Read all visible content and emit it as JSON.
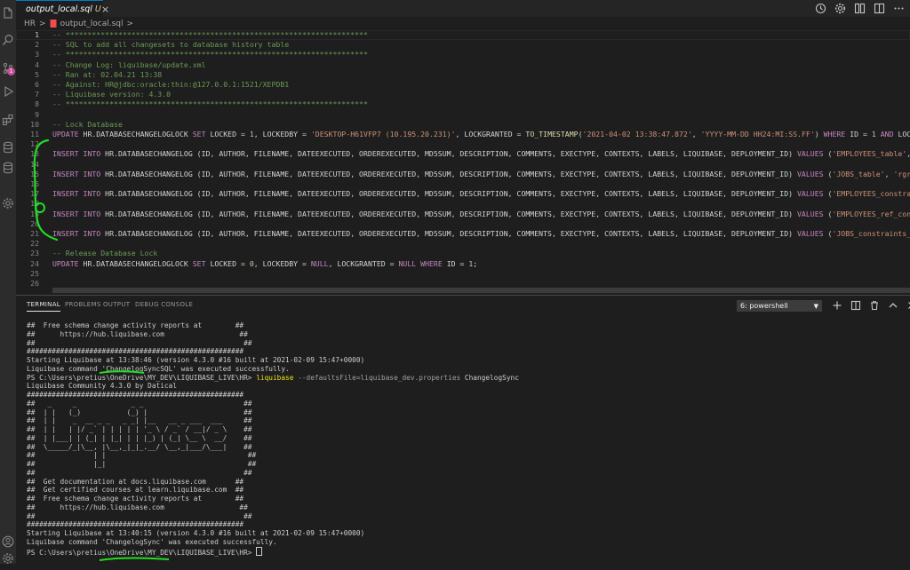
{
  "colors": {
    "accent": "#007acc",
    "comment": "#6a9955",
    "keyword": "#c586c0",
    "string": "#ce9178",
    "number": "#b5cea8",
    "function": "#dcdcaa",
    "terminal_command": "#e5e510",
    "annotation": "#22dd22"
  },
  "activity_bar": {
    "icons": [
      "files-icon",
      "search-icon",
      "source-control-icon",
      "run-debug-icon",
      "extensions-icon",
      "database-icon",
      "database-icon",
      "settings-gear-icon",
      "account-icon",
      "manage-gear-icon"
    ],
    "badge": "1"
  },
  "tab": {
    "label": "output_local.sql",
    "status": "U",
    "close": "×"
  },
  "editor_actions": [
    "history-icon",
    "gear-icon",
    "compare-icon",
    "split-editor-icon",
    "more-icon"
  ],
  "breadcrumb": {
    "folder": "HR",
    "sep": ">",
    "file": "output_local.sql",
    "tail": ">"
  },
  "editor": {
    "line_numbers": [
      "1",
      "2",
      "3",
      "4",
      "5",
      "6",
      "7",
      "8",
      "9",
      "10",
      "11",
      "12",
      "13",
      "14",
      "15",
      "16",
      "17",
      "18",
      "19",
      "20",
      "21",
      "22",
      "23",
      "24",
      "25",
      "26"
    ],
    "lines": [
      [
        {
          "t": "cmt",
          "v": "-- *********************************************************************"
        }
      ],
      [
        {
          "t": "cmt",
          "v": "-- SQL to add all changesets to database history table"
        }
      ],
      [
        {
          "t": "cmt",
          "v": "-- *********************************************************************"
        }
      ],
      [
        {
          "t": "cmt",
          "v": "-- Change Log: liquibase/update.xml"
        }
      ],
      [
        {
          "t": "cmt",
          "v": "-- Ran at: 02.04.21 13:38"
        }
      ],
      [
        {
          "t": "cmt",
          "v": "-- Against: HR@jdbc:oracle:thin:@127.0.0.1:1521/XEPDB1"
        }
      ],
      [
        {
          "t": "cmt",
          "v": "-- Liquibase version: 4.3.0"
        }
      ],
      [
        {
          "t": "cmt",
          "v": "-- *********************************************************************"
        }
      ],
      [],
      [
        {
          "t": "cmt",
          "v": "-- Lock Database"
        }
      ],
      [
        {
          "t": "kw",
          "v": "UPDATE "
        },
        {
          "t": "idn",
          "v": "HR.DATABASECHANGELOGLOCK "
        },
        {
          "t": "kw",
          "v": "SET "
        },
        {
          "t": "idn",
          "v": "LOCKED = "
        },
        {
          "t": "num",
          "v": "1"
        },
        {
          "t": "idn",
          "v": ", LOCKEDBY = "
        },
        {
          "t": "str",
          "v": "'DESKTOP-H61VFP7 (10.195.20.231)'"
        },
        {
          "t": "idn",
          "v": ", LOCKGRANTED = "
        },
        {
          "t": "fn",
          "v": "TO_TIMESTAMP"
        },
        {
          "t": "idn",
          "v": "("
        },
        {
          "t": "str",
          "v": "'2021-04-02 13:38:47.872'"
        },
        {
          "t": "idn",
          "v": ", "
        },
        {
          "t": "str",
          "v": "'YYYY-MM-DD HH24:MI:SS.FF'"
        },
        {
          "t": "idn",
          "v": ") "
        },
        {
          "t": "kw",
          "v": "WHERE "
        },
        {
          "t": "idn",
          "v": "ID = "
        },
        {
          "t": "num",
          "v": "1 "
        },
        {
          "t": "kw",
          "v": "AND "
        },
        {
          "t": "idn",
          "v": "LOCKED = "
        },
        {
          "t": "num",
          "v": "0"
        },
        {
          "t": "idn",
          "v": ";"
        }
      ],
      [],
      [
        {
          "t": "kw",
          "v": "INSERT INTO "
        },
        {
          "t": "idn",
          "v": "HR.DATABASECHANGELOG (ID, AUTHOR, FILENAME, DATEEXECUTED, ORDEREXECUTED, MD5SUM, DESCRIPTION, COMMENTS, EXECTYPE, CONTEXTS, LABELS, LIQUIBASE, DEPLOYMENT_ID) "
        },
        {
          "t": "kw",
          "v": "VALUES "
        },
        {
          "t": "idn",
          "v": "("
        },
        {
          "t": "str",
          "v": "'EMPLOYEES_table'"
        },
        {
          "t": "idn",
          "v": ", "
        },
        {
          "t": "str",
          "v": "'rgrzegorczyk'"
        }
      ],
      [],
      [
        {
          "t": "kw",
          "v": "INSERT INTO "
        },
        {
          "t": "idn",
          "v": "HR.DATABASECHANGELOG (ID, AUTHOR, FILENAME, DATEEXECUTED, ORDEREXECUTED, MD5SUM, DESCRIPTION, COMMENTS, EXECTYPE, CONTEXTS, LABELS, LIQUIBASE, DEPLOYMENT_ID) "
        },
        {
          "t": "kw",
          "v": "VALUES "
        },
        {
          "t": "idn",
          "v": "("
        },
        {
          "t": "str",
          "v": "'JOBS_table'"
        },
        {
          "t": "idn",
          "v": ", "
        },
        {
          "t": "str",
          "v": "'rgrzegorczyk'"
        },
        {
          "t": "idn",
          "v": ", "
        },
        {
          "t": "str",
          "v": "'sc"
        }
      ],
      [],
      [
        {
          "t": "kw",
          "v": "INSERT INTO "
        },
        {
          "t": "idn",
          "v": "HR.DATABASECHANGELOG (ID, AUTHOR, FILENAME, DATEEXECUTED, ORDEREXECUTED, MD5SUM, DESCRIPTION, COMMENTS, EXECTYPE, CONTEXTS, LABELS, LIQUIBASE, DEPLOYMENT_ID) "
        },
        {
          "t": "kw",
          "v": "VALUES "
        },
        {
          "t": "idn",
          "v": "("
        },
        {
          "t": "str",
          "v": "'EMPLOYEES_constraints_indexes'"
        },
        {
          "t": "idn",
          "v": ","
        }
      ],
      [],
      [
        {
          "t": "kw",
          "v": "INSERT INTO "
        },
        {
          "t": "idn",
          "v": "HR.DATABASECHANGELOG (ID, AUTHOR, FILENAME, DATEEXECUTED, ORDEREXECUTED, MD5SUM, DESCRIPTION, COMMENTS, EXECTYPE, CONTEXTS, LABELS, LIQUIBASE, DEPLOYMENT_ID) "
        },
        {
          "t": "kw",
          "v": "VALUES "
        },
        {
          "t": "idn",
          "v": "("
        },
        {
          "t": "str",
          "v": "'EMPLOYEES_ref_constraints'"
        },
        {
          "t": "idn",
          "v": ", "
        },
        {
          "t": "str",
          "v": "'rgr"
        }
      ],
      [],
      [
        {
          "t": "kw",
          "v": "INSERT INTO "
        },
        {
          "t": "idn",
          "v": "HR.DATABASECHANGELOG (ID, AUTHOR, FILENAME, DATEEXECUTED, ORDEREXECUTED, MD5SUM, DESCRIPTION, COMMENTS, EXECTYPE, CONTEXTS, LABELS, LIQUIBASE, DEPLOYMENT_ID) "
        },
        {
          "t": "kw",
          "v": "VALUES "
        },
        {
          "t": "idn",
          "v": "("
        },
        {
          "t": "str",
          "v": "'JOBS_constraints_indexes'"
        },
        {
          "t": "idn",
          "v": ", "
        },
        {
          "t": "str",
          "v": "'rgrz"
        }
      ],
      [],
      [
        {
          "t": "cmt",
          "v": "-- Release Database Lock"
        }
      ],
      [
        {
          "t": "kw",
          "v": "UPDATE "
        },
        {
          "t": "idn",
          "v": "HR.DATABASECHANGELOGLOCK "
        },
        {
          "t": "kw",
          "v": "SET "
        },
        {
          "t": "idn",
          "v": "LOCKED = "
        },
        {
          "t": "num",
          "v": "0"
        },
        {
          "t": "idn",
          "v": ", LOCKEDBY = "
        },
        {
          "t": "kw",
          "v": "NULL"
        },
        {
          "t": "idn",
          "v": ", LOCKGRANTED = "
        },
        {
          "t": "kw",
          "v": "NULL "
        },
        {
          "t": "kw",
          "v": "WHERE "
        },
        {
          "t": "idn",
          "v": "ID = "
        },
        {
          "t": "num",
          "v": "1"
        },
        {
          "t": "idn",
          "v": ";"
        }
      ],
      [],
      []
    ]
  },
  "panel": {
    "tabs": [
      "TERMINAL",
      "PROBLEMS",
      "OUTPUT",
      "DEBUG CONSOLE"
    ],
    "active_tab": "TERMINAL",
    "terminal_select": "6: powershell",
    "actions": [
      "add-terminal-icon",
      "split-terminal-icon",
      "trash-icon",
      "maximize-panel-icon",
      "close-panel-icon"
    ]
  },
  "terminal": {
    "lines": [
      [
        {
          "t": "p",
          "v": "##  Free schema change activity reports at        ##"
        }
      ],
      [
        {
          "t": "p",
          "v": "##      https://hub.liquibase.com                  ##"
        }
      ],
      [
        {
          "t": "p",
          "v": "##                                                  ##"
        }
      ],
      [
        {
          "t": "p",
          "v": "####################################################"
        }
      ],
      [
        {
          "t": "p",
          "v": "Starting Liquibase at 13:38:46 (version 4.3.0 #16 built at 2021-02-09 15:47+0000)"
        }
      ],
      [
        {
          "t": "p",
          "v": "Liquibase command 'ChangelogSyncSQL' was executed successfully."
        }
      ],
      [
        {
          "t": "p",
          "v": "PS C:\\Users\\pretius\\OneDrive\\MY_DEV\\LIQUIBASE_LIVE\\HR> "
        },
        {
          "t": "cmd",
          "v": "liquibase"
        },
        {
          "t": "param",
          "v": " --defaultsFile=liquibase_dev.properties"
        },
        {
          "t": "p",
          "v": " ChangelogSync"
        }
      ],
      [
        {
          "t": "p",
          "v": "Liquibase Community 4.3.0 by Datical"
        }
      ],
      [
        {
          "t": "p",
          "v": "####################################################"
        }
      ],
      [
        {
          "t": "p",
          "v": "##   _     _             _ _                        ##"
        }
      ],
      [
        {
          "t": "p",
          "v": "##  | |   (_)           (_) |                       ##"
        }
      ],
      [
        {
          "t": "p",
          "v": "##  | |    _  __ _ _   _ _| |__   __ _ ___  ___     ##"
        }
      ],
      [
        {
          "t": "p",
          "v": "##  | |   | |/ _` | | | | | '_ \\ / _` / __|/ _ \\    ##"
        }
      ],
      [
        {
          "t": "p",
          "v": "##  | |___| | (_| | |_| | | |_) | (_| \\__ \\  __/    ##"
        }
      ],
      [
        {
          "t": "p",
          "v": "##  \\_____/_|\\__, |\\__,_|_|_.__/ \\__,_|___/\\___|    ##"
        }
      ],
      [
        {
          "t": "p",
          "v": "##              | |                                  ##"
        }
      ],
      [
        {
          "t": "p",
          "v": "##              |_|                                  ##"
        }
      ],
      [
        {
          "t": "p",
          "v": "##                                                  ##"
        }
      ],
      [
        {
          "t": "p",
          "v": "##  Get documentation at docs.liquibase.com       ##"
        }
      ],
      [
        {
          "t": "p",
          "v": "##  Get certified courses at learn.liquibase.com  ##"
        }
      ],
      [
        {
          "t": "p",
          "v": "##  Free schema change activity reports at        ##"
        }
      ],
      [
        {
          "t": "p",
          "v": "##      https://hub.liquibase.com                  ##"
        }
      ],
      [
        {
          "t": "p",
          "v": "##                                                  ##"
        }
      ],
      [
        {
          "t": "p",
          "v": "####################################################"
        }
      ],
      [
        {
          "t": "p",
          "v": "Starting Liquibase at 13:40:15 (version 4.3.0 #16 built at 2021-02-09 15:47+0000)"
        }
      ],
      [
        {
          "t": "p",
          "v": "Liquibase command 'ChangelogSync' was executed successfully."
        }
      ],
      [
        {
          "t": "p",
          "v": "PS C:\\Users\\pretius\\OneDrive\\MY_DEV\\LIQUIBASE_LIVE\\HR> "
        }
      ]
    ]
  }
}
